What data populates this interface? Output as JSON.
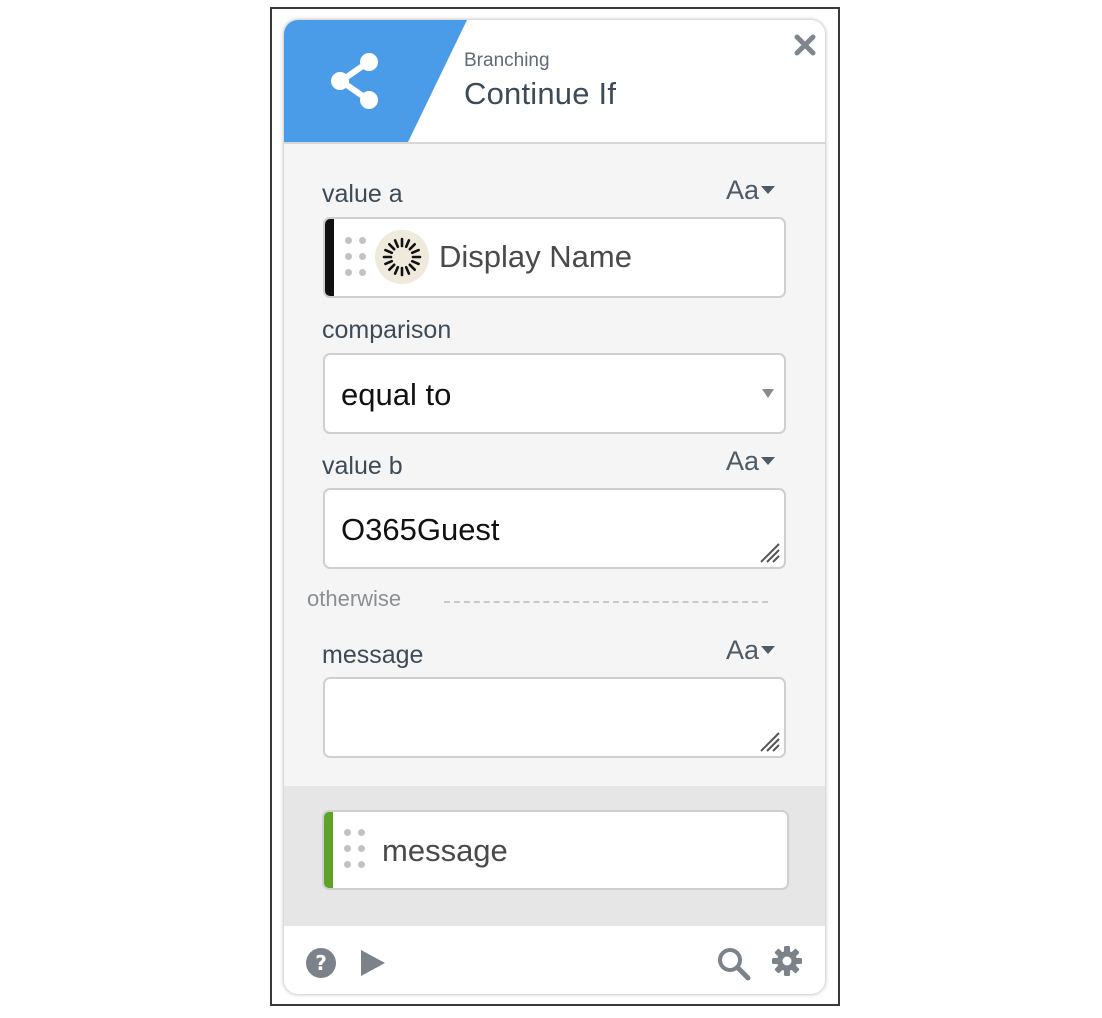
{
  "header": {
    "category": "Branching",
    "title": "Continue If",
    "accent_color": "#4a9be8",
    "icon": "share-icon",
    "close_icon": "close-icon"
  },
  "fields": {
    "value_a": {
      "label": "value a",
      "type_toggle": "Aa",
      "token": {
        "text": "Display Name",
        "icon": "avatar-sunburst-icon",
        "bar_color": "#111111"
      }
    },
    "comparison": {
      "label": "comparison",
      "selected": "equal to"
    },
    "value_b": {
      "label": "value b",
      "type_toggle": "Aa",
      "value": "O365Guest"
    },
    "otherwise": {
      "label": "otherwise"
    },
    "message": {
      "label": "message",
      "type_toggle": "Aa",
      "value": ""
    }
  },
  "output": {
    "token_text": "message",
    "bar_color": "#5ea324"
  },
  "footer": {
    "left_icons": [
      "help-icon",
      "play-icon"
    ],
    "right_icons": [
      "search-icon",
      "gear-icon"
    ]
  }
}
